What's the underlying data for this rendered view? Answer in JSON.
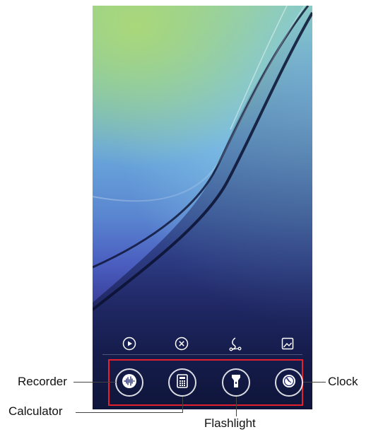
{
  "quick_actions": [
    {
      "name": "play-icon"
    },
    {
      "name": "close-circle-icon"
    },
    {
      "name": "share-route-icon"
    },
    {
      "name": "gallery-icon"
    }
  ],
  "tools": [
    {
      "name": "recorder-icon",
      "label": "Recorder"
    },
    {
      "name": "calculator-icon",
      "label": "Calculator"
    },
    {
      "name": "flashlight-icon",
      "label": "Flashlight"
    },
    {
      "name": "clock-icon",
      "label": "Clock"
    }
  ],
  "colors": {
    "highlight": "#e4202e",
    "icon": "#ffffff"
  }
}
